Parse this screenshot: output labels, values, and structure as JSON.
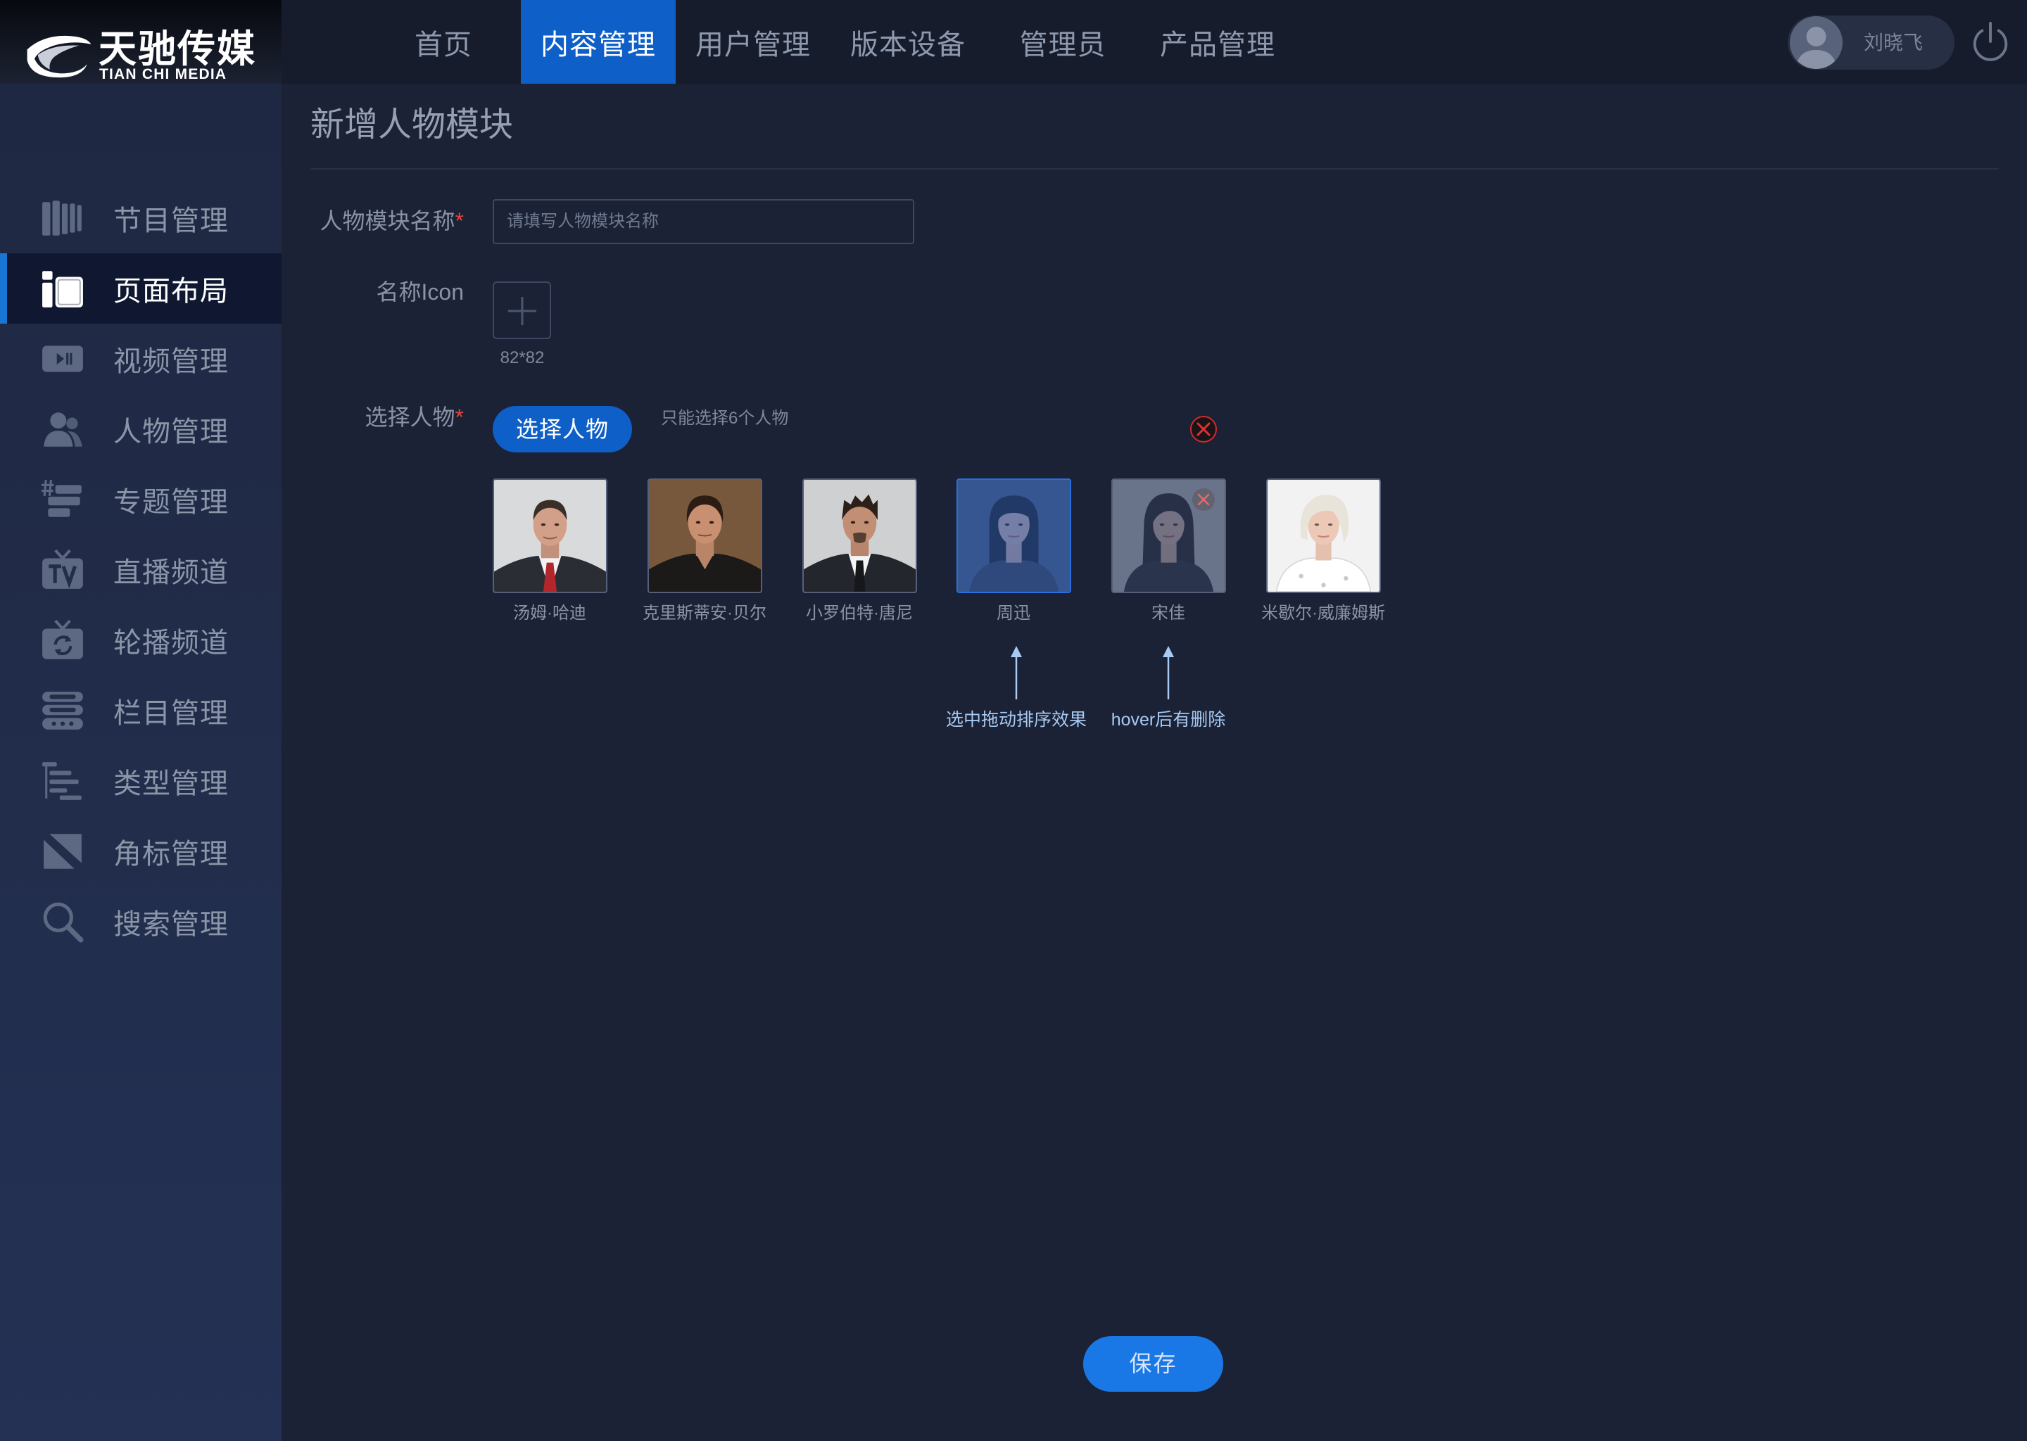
{
  "brand": {
    "name_cn": "天驰传媒",
    "name_en": "TIAN CHI MEDIA",
    "logo_icon": "swoosh-logo-icon"
  },
  "top_nav": {
    "items": [
      {
        "label": "首页",
        "active": false
      },
      {
        "label": "内容管理",
        "active": true
      },
      {
        "label": "用户管理",
        "active": false
      },
      {
        "label": "版本设备",
        "active": false
      },
      {
        "label": "管理员",
        "active": false
      },
      {
        "label": "产品管理",
        "active": false
      }
    ],
    "user": {
      "name": "刘晓飞",
      "avatar_icon": "user-avatar-icon"
    },
    "power_icon": "power-icon"
  },
  "sidebar": {
    "items": [
      {
        "label": "节目管理",
        "icon": "program-icon",
        "active": false
      },
      {
        "label": "页面布局",
        "icon": "layout-icon",
        "active": true
      },
      {
        "label": "视频管理",
        "icon": "video-icon",
        "active": false
      },
      {
        "label": "人物管理",
        "icon": "people-icon",
        "active": false
      },
      {
        "label": "专题管理",
        "icon": "topic-icon",
        "active": false
      },
      {
        "label": "直播频道",
        "icon": "tv-icon",
        "active": false
      },
      {
        "label": "轮播频道",
        "icon": "carousel-tv-icon",
        "active": false
      },
      {
        "label": "栏目管理",
        "icon": "column-icon",
        "active": false
      },
      {
        "label": "类型管理",
        "icon": "type-tree-icon",
        "active": false
      },
      {
        "label": "角标管理",
        "icon": "badge-icon",
        "active": false
      },
      {
        "label": "搜索管理",
        "icon": "search-icon",
        "active": false
      }
    ]
  },
  "page": {
    "title": "新增人物模块"
  },
  "form": {
    "name_field": {
      "label": "人物模块名称",
      "required_mark": "*",
      "value": "",
      "placeholder": "请填写人物模块名称"
    },
    "icon_field": {
      "label": "名称Icon",
      "size_hint": "82*82",
      "upload_icon": "plus-icon"
    },
    "people_field": {
      "label": "选择人物",
      "required_mark": "*",
      "button_label": "选择人物",
      "hint": "只能选择6个人物"
    },
    "people": [
      {
        "name": "汤姆·哈迪",
        "state": "normal"
      },
      {
        "name": "克里斯蒂安·贝尔",
        "state": "normal"
      },
      {
        "name": "小罗伯特·唐尼",
        "state": "normal"
      },
      {
        "name": "周迅",
        "state": "dragging"
      },
      {
        "name": "宋佳",
        "state": "hover"
      },
      {
        "name": "米歇尔·威廉姆斯",
        "state": "normal"
      }
    ],
    "delete_icon": "close-icon"
  },
  "annotations": [
    {
      "text": "选中拖动排序效果",
      "target": "周迅"
    },
    {
      "text": "hover后有删除",
      "target": "宋佳"
    }
  ],
  "save_button": {
    "label": "保存"
  },
  "colors": {
    "accent": "#0e5fc7",
    "save_button": "#1a78e6",
    "required": "#e0443e",
    "annotation": "#a7c9f2",
    "active_indicator": "#1976d2",
    "background": "#1b2236"
  }
}
